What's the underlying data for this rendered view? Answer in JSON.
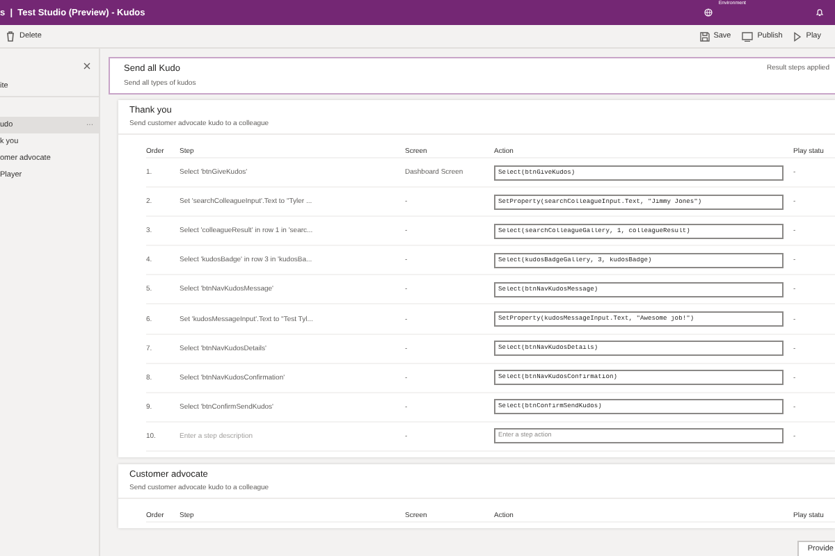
{
  "header": {
    "title": "s  |  Test Studio (Preview) - Kudos",
    "environment_label": "Environment"
  },
  "toolbar": {
    "left": [
      {
        "kind": "delete",
        "label": "Delete"
      }
    ],
    "right": [
      {
        "kind": "save",
        "label": "Save"
      },
      {
        "kind": "publish",
        "label": "Publish"
      },
      {
        "kind": "play",
        "label": "Play"
      }
    ]
  },
  "sidebar": {
    "top_item": "ite",
    "items": [
      {
        "label": "udo",
        "selected": true,
        "more": "···"
      },
      {
        "label": "k you",
        "selected": false
      },
      {
        "label": "omer advocate",
        "selected": false
      },
      {
        "label": "Player",
        "selected": false
      }
    ]
  },
  "suite": {
    "title": "Send all Kudo",
    "description": "Send all types of kudos",
    "status": "Result steps applied"
  },
  "test_cases": [
    {
      "title": "Thank you",
      "description": "Send customer advocate kudo to a colleague",
      "columns": [
        "Order",
        "Step",
        "Screen",
        "Action",
        "Play statu"
      ],
      "rows": [
        {
          "kind": "step",
          "order": "1.",
          "step": "Select 'btnGiveKudos'",
          "screen": "Dashboard Screen",
          "action": "Select(btnGiveKudos)",
          "play_status": "-"
        },
        {
          "kind": "step",
          "order": "2.",
          "step": "Set 'searchColleagueInput'.Text to \"Tyler ...",
          "screen": "-",
          "action": "SetProperty(searchColleagueInput.Text, \"Jimmy Jones\")",
          "play_status": "-"
        },
        {
          "kind": "step",
          "order": "3.",
          "step": "Select 'colleagueResult' in row 1 in 'searc...",
          "screen": "-",
          "action": "Select(searchColleagueGallery, 1, colleagueResult)",
          "play_status": "-"
        },
        {
          "kind": "step",
          "order": "4.",
          "step": "Select 'kudosBadge' in row 3 in 'kudosBa...",
          "screen": "-",
          "action": "Select(kudosBadgeGallery, 3, kudosBadge)",
          "play_status": "-"
        },
        {
          "kind": "step",
          "order": "5.",
          "step": "Select 'btnNavKudosMessage'",
          "screen": "-",
          "action": "Select(btnNavKudosMessage)",
          "play_status": "-"
        },
        {
          "kind": "step",
          "order": "6.",
          "step": "Set 'kudosMessageInput'.Text to \"Test Tyl...",
          "screen": "-",
          "action": "SetProperty(kudosMessageInput.Text, \"Awesome job!\")",
          "play_status": "-"
        },
        {
          "kind": "step",
          "order": "7.",
          "step": "Select 'btnNavKudosDetails'",
          "screen": "-",
          "action": "Select(btnNavKudosDetails)",
          "play_status": "-"
        },
        {
          "kind": "step",
          "order": "8.",
          "step": "Select 'btnNavKudosConfirmation'",
          "screen": "-",
          "action": "Select(btnNavKudosConfirmation)",
          "play_status": "-"
        },
        {
          "kind": "step",
          "order": "9.",
          "step": "Select 'btnConfirmSendKudos'",
          "screen": "-",
          "action": "Select(btnConfirmSendKudos)",
          "play_status": "-"
        },
        {
          "kind": "new",
          "order": "10.",
          "step": "Enter a step description",
          "screen": "-",
          "placeholder": "Enter a step action",
          "play_status": "-"
        }
      ]
    },
    {
      "title": "Customer advocate",
      "description": "Send customer advocate kudo to a colleague",
      "columns": [
        "Order",
        "Step",
        "Screen",
        "Action",
        "Play statu"
      ]
    }
  ],
  "feedback_button": "Provide"
}
